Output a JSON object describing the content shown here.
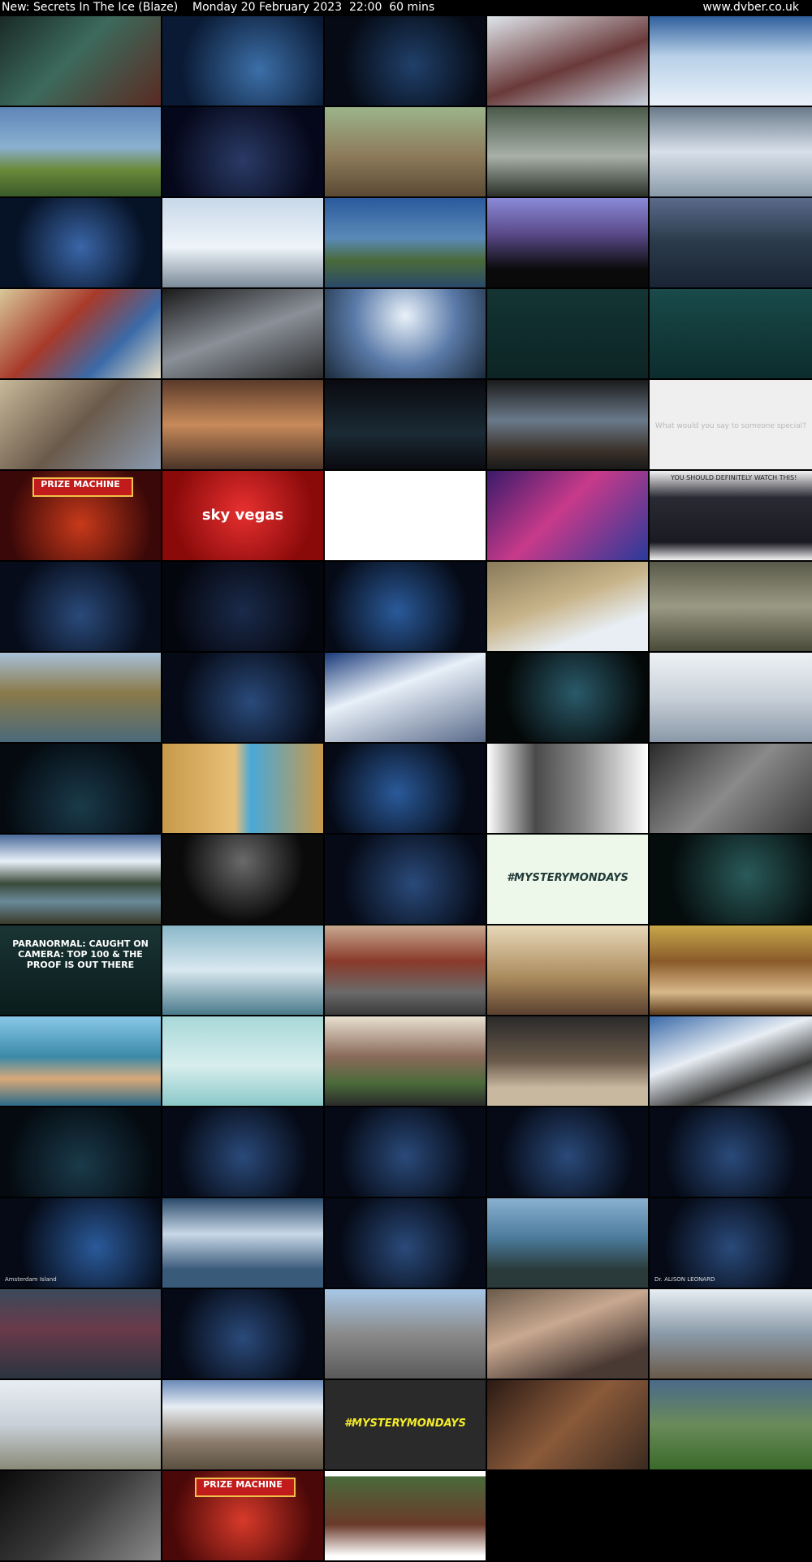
{
  "header": {
    "title": "New: Secrets In The Ice (Blaze)    Monday 20 February 2023  22:00  60 mins",
    "site": "www.dvber.co.uk"
  },
  "thumbnails": [
    [
      {
        "bg": "linear-gradient(135deg,#1a2a26,#3c6a5c 45%,#5a2a22)"
      },
      {
        "bg": "radial-gradient(circle at 60% 60%,#3c6fa8,#0a1a34 70%)"
      },
      {
        "bg": "radial-gradient(circle at 55% 55%,#20406a,#050a14 70%)"
      },
      {
        "bg": "linear-gradient(160deg,#dfe6ec,#6a3a3a 55%,#c8d2de)"
      },
      {
        "bg": "linear-gradient(180deg,#2f5f9c,#b8d0e8 45%,#eaf2fa)"
      }
    ],
    [
      {
        "bg": "linear-gradient(180deg,#5f86b8,#8ab0d0 45%,#6a8a3a 70%,#3a5a2a)"
      },
      {
        "bg": "radial-gradient(circle at 50% 60%,#2a3a66,#05081a 75%)"
      },
      {
        "bg": "linear-gradient(180deg,#9cb48a,#8c7a5a 55%,#5a4a34)"
      },
      {
        "bg": "linear-gradient(180deg,#4a5a4a,#a8b0a8 55%,#2a3028)"
      },
      {
        "bg": "linear-gradient(180deg,#6a7a8a,#d8e0ea 50%,#8a9aa8)"
      }
    ],
    [
      {
        "bg": "radial-gradient(circle at 50% 55%,#3a66a8,#061226 70%)"
      },
      {
        "bg": "linear-gradient(180deg,#c8d8e8,#eef4fa 55%,#7a8a98)"
      },
      {
        "bg": "linear-gradient(180deg,#2a5a9c,#5a8ab8 45%,#4a6a3a 70%,#2a4a6a)"
      },
      {
        "bg": "linear-gradient(180deg,#8a8ad8,#5a4a8a 40%,#0a0a0a 80%)"
      },
      {
        "bg": "linear-gradient(180deg,#5a6a8a,#2a3a4a 50%,#1a2434)"
      }
    ],
    [
      {
        "bg": "linear-gradient(135deg,#d8c89a,#a83a2a 40%,#3a6aa8 70%,#e8e0c8)"
      },
      {
        "bg": "linear-gradient(160deg,#1a1a1a,#8a9098 50%,#2a2a2a)"
      },
      {
        "bg": "radial-gradient(circle at 50% 30%,#eaf2fa,#5a7aa8 50%,#1a2a3a)"
      },
      {
        "bg": "linear-gradient(180deg,#143434,#0c2424)"
      },
      {
        "bg": "linear-gradient(180deg,#1a4a4a,#0c2c2c)"
      }
    ],
    [
      {
        "bg": "linear-gradient(135deg,#c8b89a,#6a5a4a 50%,#8a9ab0)"
      },
      {
        "bg": "linear-gradient(180deg,#5a3a2a,#c88a5a 50%,#4a3428)"
      },
      {
        "bg": "linear-gradient(180deg,#0a0a10,#1a2a34 60%,#0a0a10)"
      },
      {
        "bg": "linear-gradient(180deg,#1a1a1a,#6a7a8a 45%,#3a3028 80%,#1a1a1a)"
      },
      {
        "bg": "#efefef",
        "type": "ad",
        "cap": "What would you say to someone special?"
      }
    ],
    [
      {
        "bg": "radial-gradient(circle at 50% 60%,#c83a1a,#3a0808 75%)",
        "type": "prize",
        "cap": "PRIZE MACHINE"
      },
      {
        "bg": "radial-gradient(circle at 50% 45%,#e83030,#8a0a0a 75%)",
        "type": "brand",
        "cap": "sky vegas"
      },
      {
        "bg": "#ffffff"
      },
      {
        "bg": "linear-gradient(135deg,#3a1a6a,#c83a8a 45%,#2a3a9a)"
      },
      {
        "bg": "linear-gradient(180deg,#f4f4f4,#2a2a34 30%,#1a1a22 80%,#f4f4f4)",
        "type": "crime",
        "cap": "YOU SHOULD DEFINITELY WATCH THIS!"
      }
    ],
    [
      {
        "bg": "radial-gradient(circle at 50% 60%,#2a4a7a,#060c1a 70%)"
      },
      {
        "bg": "radial-gradient(circle at 50% 55%,#1a2a4a,#04060e 75%)"
      },
      {
        "bg": "radial-gradient(circle at 45% 55%,#2a5a9a,#050a16 70%)"
      },
      {
        "bg": "linear-gradient(160deg,#8a7a5a,#c8b48a 45%,#e8eef4 75%)"
      },
      {
        "bg": "linear-gradient(180deg,#5a5a4a,#9a9a84 50%,#4a4a3a)"
      }
    ],
    [
      {
        "bg": "linear-gradient(180deg,#a8c0d8,#8a7a4a 45%,#4a6a7a)"
      },
      {
        "bg": "radial-gradient(circle at 55% 55%,#2a4a7a,#050a16 70%)"
      },
      {
        "bg": "linear-gradient(160deg,#1a3a7a,#e8f0f8 40%,#5a6a8a)"
      },
      {
        "bg": "radial-gradient(circle at 55% 45%,#2a5a6a,#040808 70%)"
      },
      {
        "bg": "linear-gradient(180deg,#eef2f6,#c8d0d8 50%,#8a98a8)"
      }
    ],
    [
      {
        "bg": "radial-gradient(circle at 50% 70%,#1a3a4a,#040a10 75%)"
      },
      {
        "bg": "linear-gradient(90deg,#c89a4a,#e8c078 45%,#4aa8d8 55%,#c89a4a)"
      },
      {
        "bg": "radial-gradient(circle at 45% 55%,#2a5a9a,#050a16 70%)"
      },
      {
        "bg": "linear-gradient(90deg,#ffffff,#4a4a4a 30%,#8a8a8a 60%,#ffffff)"
      },
      {
        "bg": "linear-gradient(135deg,#2a2a2a,#8a8a8a 50%,#3a3a3a)"
      }
    ],
    [
      {
        "bg": "linear-gradient(180deg,#4a6a9a,#e8f0f8 30%,#3a4a3a 55%,#6a8a9a 75%,#3a3a2a)"
      },
      {
        "bg": "radial-gradient(circle at 50% 30%,#6a6a6a,#0a0a0a 60%)"
      },
      {
        "bg": "radial-gradient(circle at 55% 55%,#2a4a7a,#050a16 70%)"
      },
      {
        "bg": "#eef8ea",
        "type": "tagline",
        "cap": "#MYSTERYMONDAYS"
      },
      {
        "bg": "radial-gradient(circle at 60% 45%,#2a5a5a,#050c0c 70%)"
      }
    ],
    [
      {
        "bg": "linear-gradient(180deg,#1a3434,#0a1c1c)",
        "type": "promo",
        "cap": "PARANORMAL: CAUGHT ON CAMERA: TOP 100 & THE PROOF IS OUT THERE"
      },
      {
        "bg": "linear-gradient(180deg,#8ab8c8,#d8e8f0 50%,#4a7a8a)"
      },
      {
        "bg": "linear-gradient(180deg,#c8a890,#8a3a2a 40%,#6a6a6a 75%,#3a3a3a)"
      },
      {
        "bg": "linear-gradient(180deg,#e8d8b8,#a8885a 60%,#5a4030)"
      },
      {
        "bg": "linear-gradient(180deg,#c8a84a,#8a5a2a 40%,#d8b88a 75%,#5a3a1a)"
      }
    ],
    [
      {
        "bg": "linear-gradient(180deg,#8ac8e8,#3a8aa8 45%,#d8a878 70%,#2a6a8a)"
      },
      {
        "bg": "linear-gradient(180deg,#a8d8d8,#d8eeee 55%,#8ac8c8)"
      },
      {
        "bg": "linear-gradient(180deg,#e8e0d0,#8a6a5a 45%,#4a6a3a 75%,#2a2a2a)"
      },
      {
        "bg": "linear-gradient(180deg,#2a2a2a,#6a5a4a 50%,#c8b8a0 80%)"
      },
      {
        "bg": "linear-gradient(160deg,#3a6aa8,#e8eef4 40%,#3a3a3a 70%,#e8eef4)"
      }
    ],
    [
      {
        "bg": "radial-gradient(circle at 50% 65%,#1a3a4a,#040a10 75%)"
      },
      {
        "bg": "radial-gradient(circle at 50% 55%,#2a4a7a,#050a16 70%)"
      },
      {
        "bg": "radial-gradient(circle at 50% 55%,#2a4a7a,#050a16 70%)"
      },
      {
        "bg": "radial-gradient(circle at 50% 55%,#2a4a7a,#050a16 70%)"
      },
      {
        "bg": "radial-gradient(circle at 50% 55%,#2a4a7a,#050a16 70%)"
      }
    ],
    [
      {
        "bg": "radial-gradient(circle at 60% 55%,#2a5a9a,#050a16 70%)",
        "label": "Amsterdam Island"
      },
      {
        "bg": "linear-gradient(180deg,#2a4a6a,#c8d8e8 40%,#3a5a7a 80%)"
      },
      {
        "bg": "radial-gradient(circle at 50% 55%,#2a4a7a,#050a16 70%)"
      },
      {
        "bg": "linear-gradient(180deg,#8ab0d0,#4a7a9a 45%,#2a3a3a 80%)"
      },
      {
        "bg": "radial-gradient(circle at 50% 55%,#2a4a7a,#050a16 70%)",
        "label": "Dr. ALISON LEONARD"
      }
    ],
    [
      {
        "bg": "linear-gradient(180deg,#3a4a5a,#6a3a4a 45%,#2a3440)"
      },
      {
        "bg": "radial-gradient(circle at 50% 55%,#2a4a7a,#050a16 70%)"
      },
      {
        "bg": "linear-gradient(180deg,#a8c8e8,#8a8a8a 50%,#5a5a5a)"
      },
      {
        "bg": "linear-gradient(160deg,#6a5a4a,#c8a890 40%,#4a3a34 80%)"
      },
      {
        "bg": "linear-gradient(180deg,#e8eef4,#8a9aa8 50%,#6a5a4a)"
      }
    ],
    [
      {
        "bg": "linear-gradient(180deg,#e8eef2,#c8d0d8 50%,#8a8a78)"
      },
      {
        "bg": "linear-gradient(180deg,#6a8ab8,#e8eef4 30%,#8a7a6a 70%,#5a5040)"
      },
      {
        "bg": "#2a2a2a",
        "type": "tagline dark",
        "cap": "#MYSTERYMONDAYS"
      },
      {
        "bg": "linear-gradient(135deg,#2a1a14,#8a5a3a 50%,#3a2a20)"
      },
      {
        "bg": "linear-gradient(180deg,#4a6a8a,#6a8a5a 50%,#3a6a2a)"
      }
    ],
    [
      {
        "bg": "linear-gradient(135deg,#0a0a0a,#3a3a3a 50%,#8a8a8a)"
      },
      {
        "bg": "radial-gradient(circle at 50% 55%,#d83a2a,#4a0808 75%)",
        "type": "prize",
        "cap": "PRIZE MACHINE"
      },
      {
        "bg": "linear-gradient(180deg,#ffffff 0%,#ffffff 6%,#4a6a3a 6%,#6a3a2a 60%,#ffffff 95%)"
      },
      {
        "bg": "#000000"
      },
      {
        "bg": "#000000"
      }
    ]
  ]
}
